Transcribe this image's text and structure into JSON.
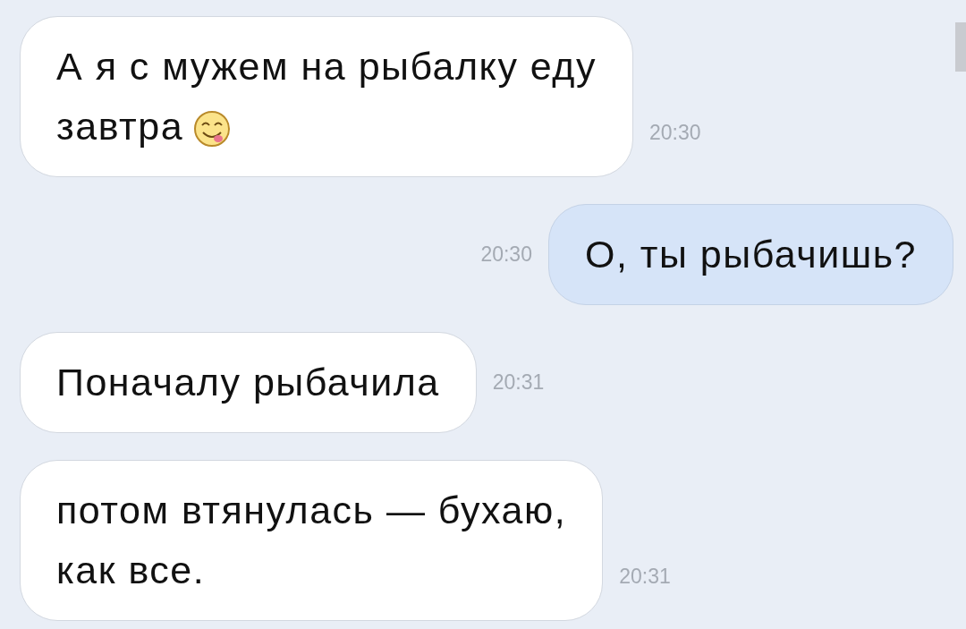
{
  "messages": [
    {
      "kind": "incoming",
      "text": "А я с мужем на рыбалку еду\nзавтра",
      "has_emoji": true,
      "time": "20:30"
    },
    {
      "kind": "outgoing",
      "text": "О, ты рыбачишь?",
      "has_emoji": false,
      "time": "20:30"
    },
    {
      "kind": "incoming",
      "text": "Поначалу рыбачила",
      "has_emoji": false,
      "time": "20:31"
    },
    {
      "kind": "incoming",
      "text": "потом втянулась — бухаю,\nкак все.",
      "has_emoji": false,
      "time": "20:31"
    }
  ]
}
